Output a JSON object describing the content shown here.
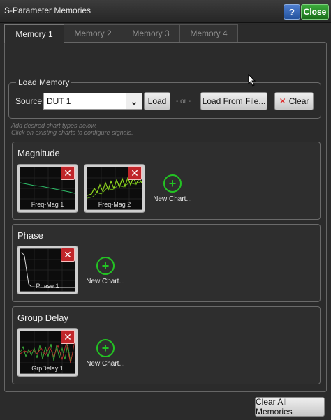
{
  "window": {
    "title": "S-Parameter Memories",
    "help_label": "?",
    "close_label": "Close"
  },
  "tabs": [
    {
      "label": "Memory 1",
      "active": true
    },
    {
      "label": "Memory 2",
      "active": false
    },
    {
      "label": "Memory 3",
      "active": false
    },
    {
      "label": "Memory 4",
      "active": false
    }
  ],
  "load_memory": {
    "title": "Load Memory",
    "source_label": "Source:",
    "source_value": "DUT 1",
    "load_label": "Load",
    "or_text": "- or -",
    "load_file_label": "Load From File...",
    "clear_label": "Clear"
  },
  "hints": {
    "line1": "Add desired chart types below.",
    "line2": "Click on existing charts to configure signals."
  },
  "sections": [
    {
      "title": "Magnitude",
      "charts": [
        "Freq-Mag 1",
        "Freq-Mag 2"
      ],
      "new_chart_label": "New Chart..."
    },
    {
      "title": "Phase",
      "charts": [
        "Phase 1"
      ],
      "new_chart_label": "New Chart..."
    },
    {
      "title": "Group Delay",
      "charts": [
        "GrpDelay 1"
      ],
      "new_chart_label": "New Chart..."
    }
  ],
  "footer": {
    "clear_all_label": "Clear All Memories"
  },
  "colors": {
    "close_green": "#2a9a2a",
    "help_blue": "#2f63b5",
    "delete_red": "#c0262a",
    "add_green": "#23c323"
  }
}
